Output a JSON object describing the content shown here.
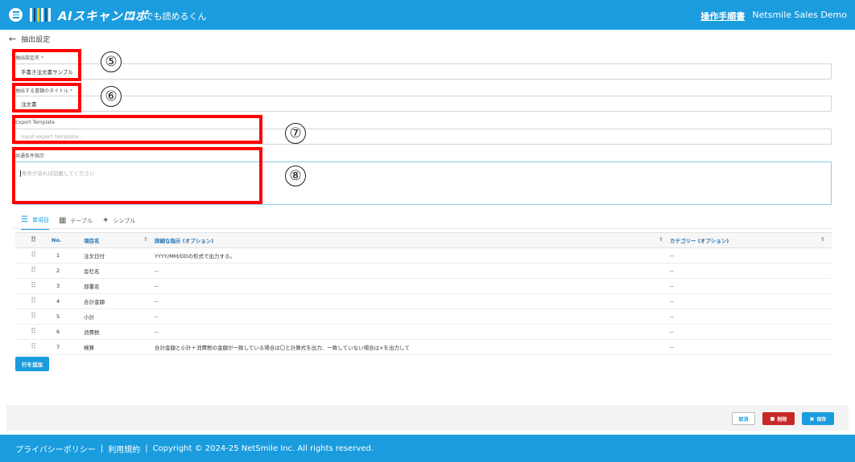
{
  "header": {
    "logo_text": "AIスキャンロボ",
    "logo_subtitle": "なんでも読めるくん",
    "manual_link": "操作手順書",
    "account_name": "Netsmile Sales Demo"
  },
  "breadcrumb": {
    "title": "抽出設定"
  },
  "form": {
    "name_label": "抽出設定名",
    "name_value": "手書き注文書サンプル",
    "doc_title_label": "抽出する書類のタイトル",
    "doc_title_value": "注文書",
    "export_label": "Export Template",
    "export_placeholder": "Input export template...",
    "condition_label": "共通条件指示",
    "condition_placeholder": "条件があれば記載してください",
    "required_mark": "*"
  },
  "annotations": [
    "⑤",
    "⑥",
    "⑦",
    "⑧"
  ],
  "tabs": [
    {
      "label": "単項目",
      "active": true
    },
    {
      "label": "テーブル",
      "active": false
    },
    {
      "label": "シンプル",
      "active": false
    }
  ],
  "table": {
    "headers": {
      "no": "No.",
      "name": "項目名",
      "detail": "詳細な指示 (オプション)",
      "category": "カテゴリー (オプション)"
    },
    "rows": [
      {
        "no": "1",
        "name": "注文日付",
        "detail": "YYYY/MM/DDの形式で出力する。",
        "category": "--"
      },
      {
        "no": "2",
        "name": "会社名",
        "detail": "--",
        "category": "--"
      },
      {
        "no": "3",
        "name": "部署名",
        "detail": "--",
        "category": "--"
      },
      {
        "no": "4",
        "name": "合計金額",
        "detail": "--",
        "category": "--"
      },
      {
        "no": "5",
        "name": "小計",
        "detail": "--",
        "category": "--"
      },
      {
        "no": "6",
        "name": "消費税",
        "detail": "--",
        "category": "--"
      },
      {
        "no": "7",
        "name": "検算",
        "detail": "合計金額と小計＋消費税の金額が一致している場合は〇と計算式を出力、一致していない場合は×を出力して",
        "category": "--"
      }
    ]
  },
  "add_row_label": "行を追加",
  "actions": {
    "cancel": "取消",
    "delete": "削除",
    "save": "保存"
  },
  "footer": {
    "privacy": "プライバシーポリシー",
    "sep1": "|",
    "terms": "利用規約",
    "sep2": "|",
    "copyright": "Copyright © 2024-25 NetSmile Inc. All rights reserved."
  },
  "colors": {
    "primary": "#1a9cde",
    "danger": "#c62828",
    "annotation": "#ff0000"
  }
}
